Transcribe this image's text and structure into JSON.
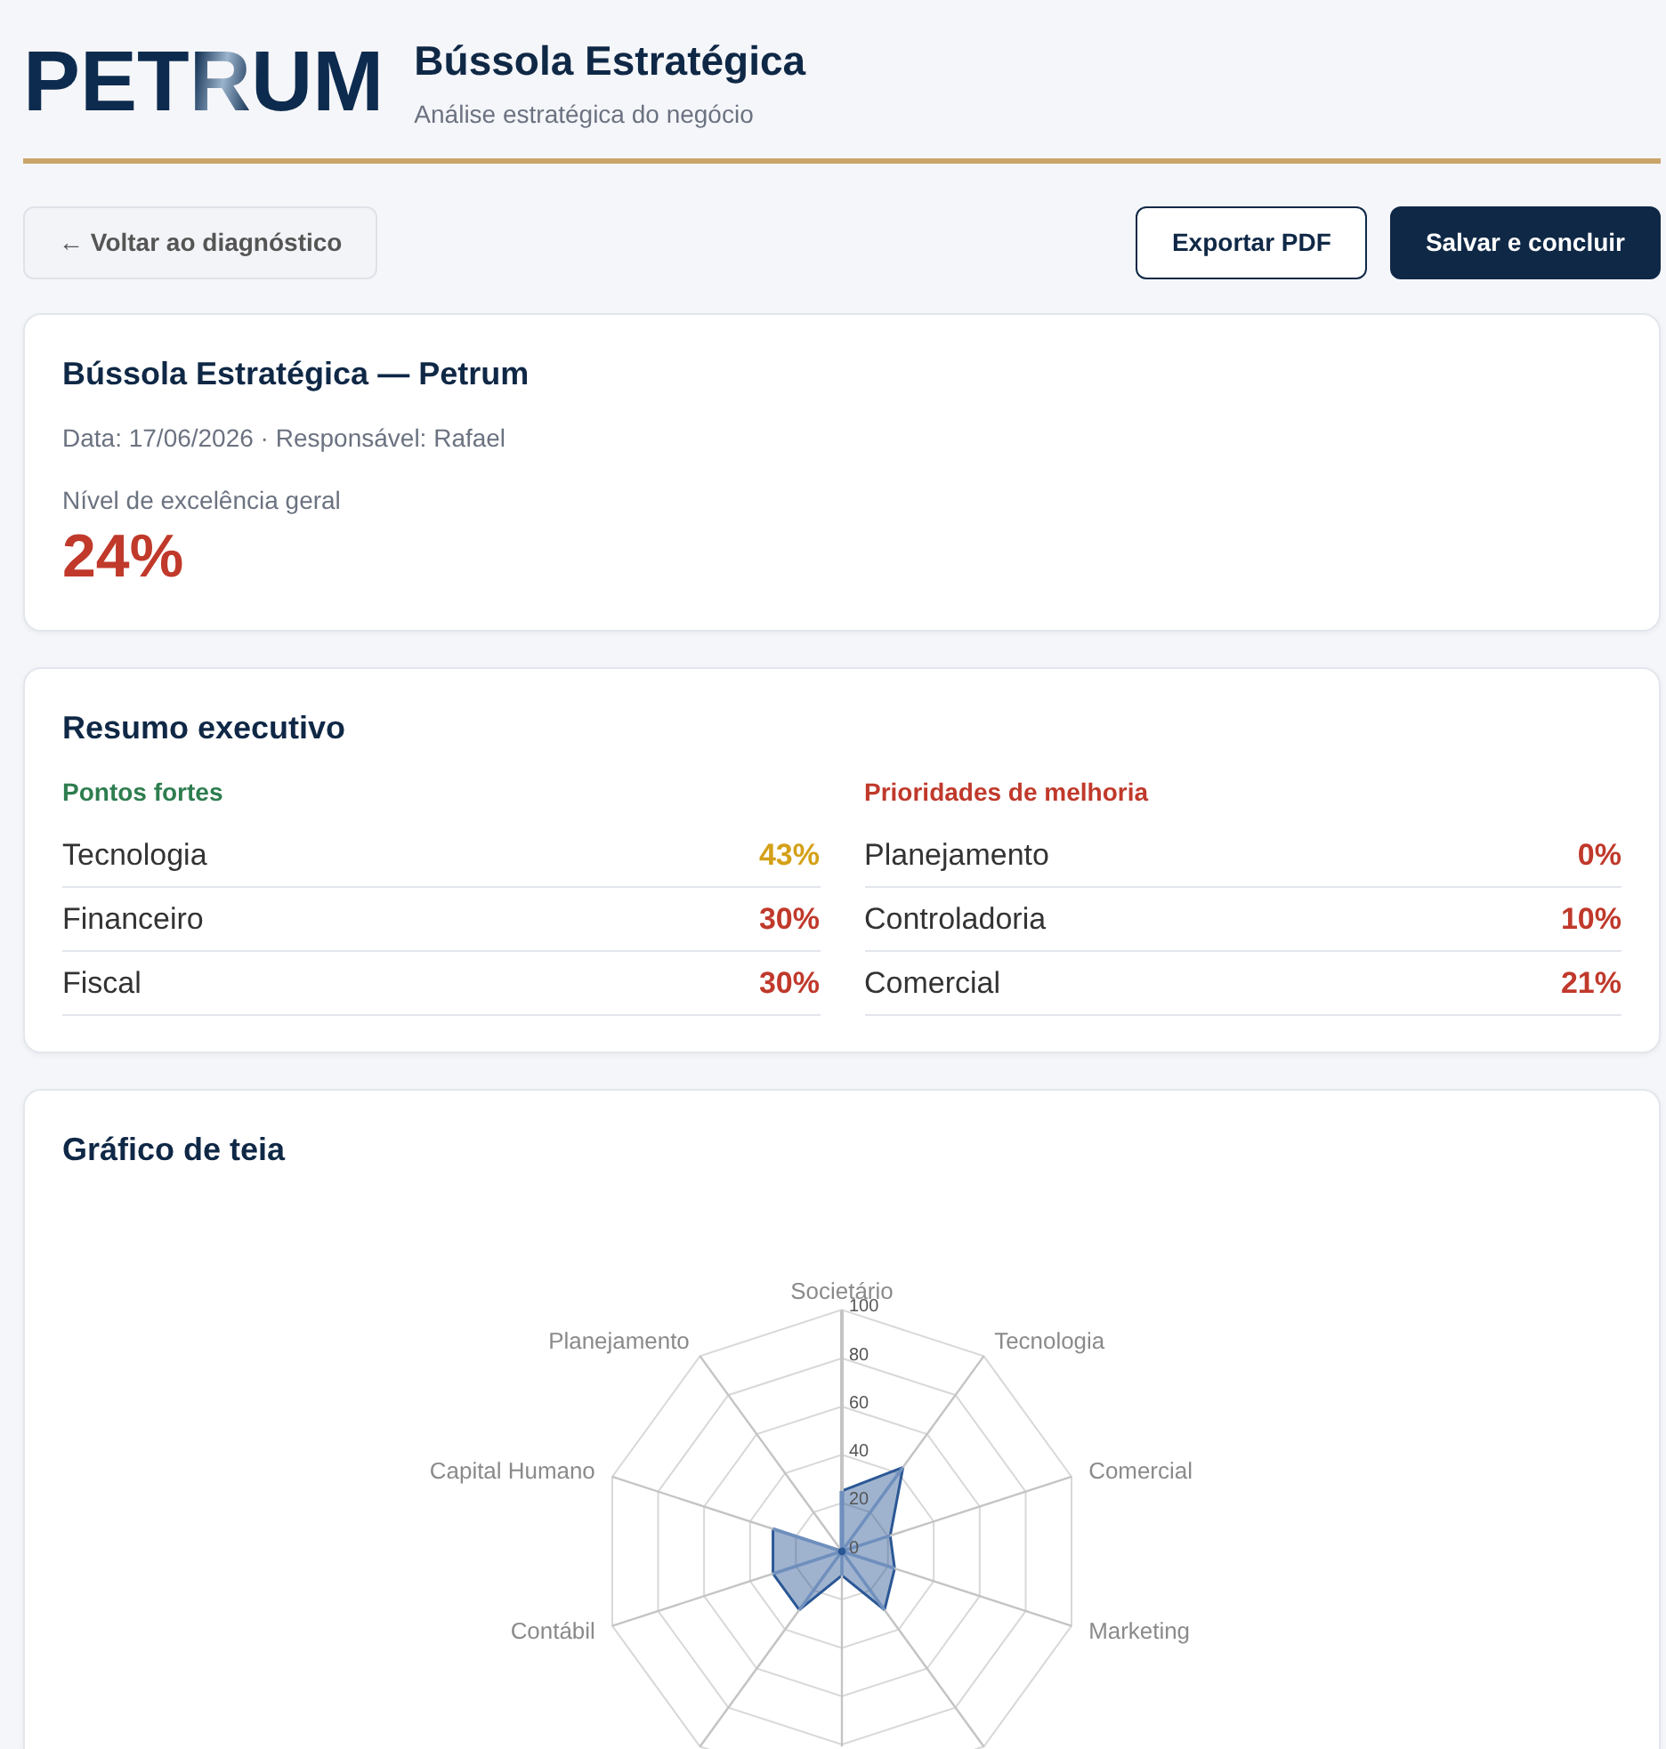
{
  "header": {
    "logo": "PETRUM",
    "title": "Bússola Estratégica",
    "subtitle": "Análise estratégica do negócio"
  },
  "toolbar": {
    "back_button": "← Voltar ao diagnóstico",
    "buttons": [
      {
        "label": "Exportar PDF",
        "kind": "outline"
      },
      {
        "label": "Salvar e concluir",
        "kind": "primary"
      }
    ]
  },
  "overview": {
    "title": "Bússola Estratégica — Petrum",
    "meta": "Data: 17/06/2026 · Responsável: Rafael",
    "score_label": "Nível de excelência geral",
    "score": "24%"
  },
  "summary": {
    "title": "Resumo executivo",
    "columns": [
      {
        "heading": "Pontos fortes",
        "kind": "strengths",
        "items": [
          {
            "name": "Tecnologia",
            "value": "43%",
            "color": "#d4a017"
          },
          {
            "name": "Financeiro",
            "value": "30%",
            "color": "#c0392b"
          },
          {
            "name": "Fiscal",
            "value": "30%",
            "color": "#c0392b"
          }
        ]
      },
      {
        "heading": "Prioridades de melhoria",
        "kind": "priorities",
        "items": [
          {
            "name": "Planejamento",
            "value": "0%",
            "color": "#c0392b"
          },
          {
            "name": "Controladoria",
            "value": "10%",
            "color": "#c0392b"
          },
          {
            "name": "Comercial",
            "value": "21%",
            "color": "#c0392b"
          }
        ]
      }
    ]
  },
  "web_chart": {
    "title": "Gráfico de teia",
    "scale": [
      "100",
      "80",
      "60",
      "40",
      "20",
      "0"
    ],
    "right_axes": [
      {
        "label": "Societário",
        "level": 0.25
      },
      {
        "label": "Tecnologia",
        "level": 0.43
      },
      {
        "label": "Comercial",
        "level": 0.21
      },
      {
        "label": "Marketing",
        "level": 0.23
      },
      {
        "level": 0.3
      },
      {
        "level": 0.1
      }
    ],
    "left_axes": [
      {
        "label": "Planejamento",
        "level": 0
      },
      {
        "label": "Capital Humano",
        "level": 0.3
      },
      {
        "label": "Contábil",
        "level": 0.3
      },
      {
        "level": 0.3
      }
    ]
  }
}
